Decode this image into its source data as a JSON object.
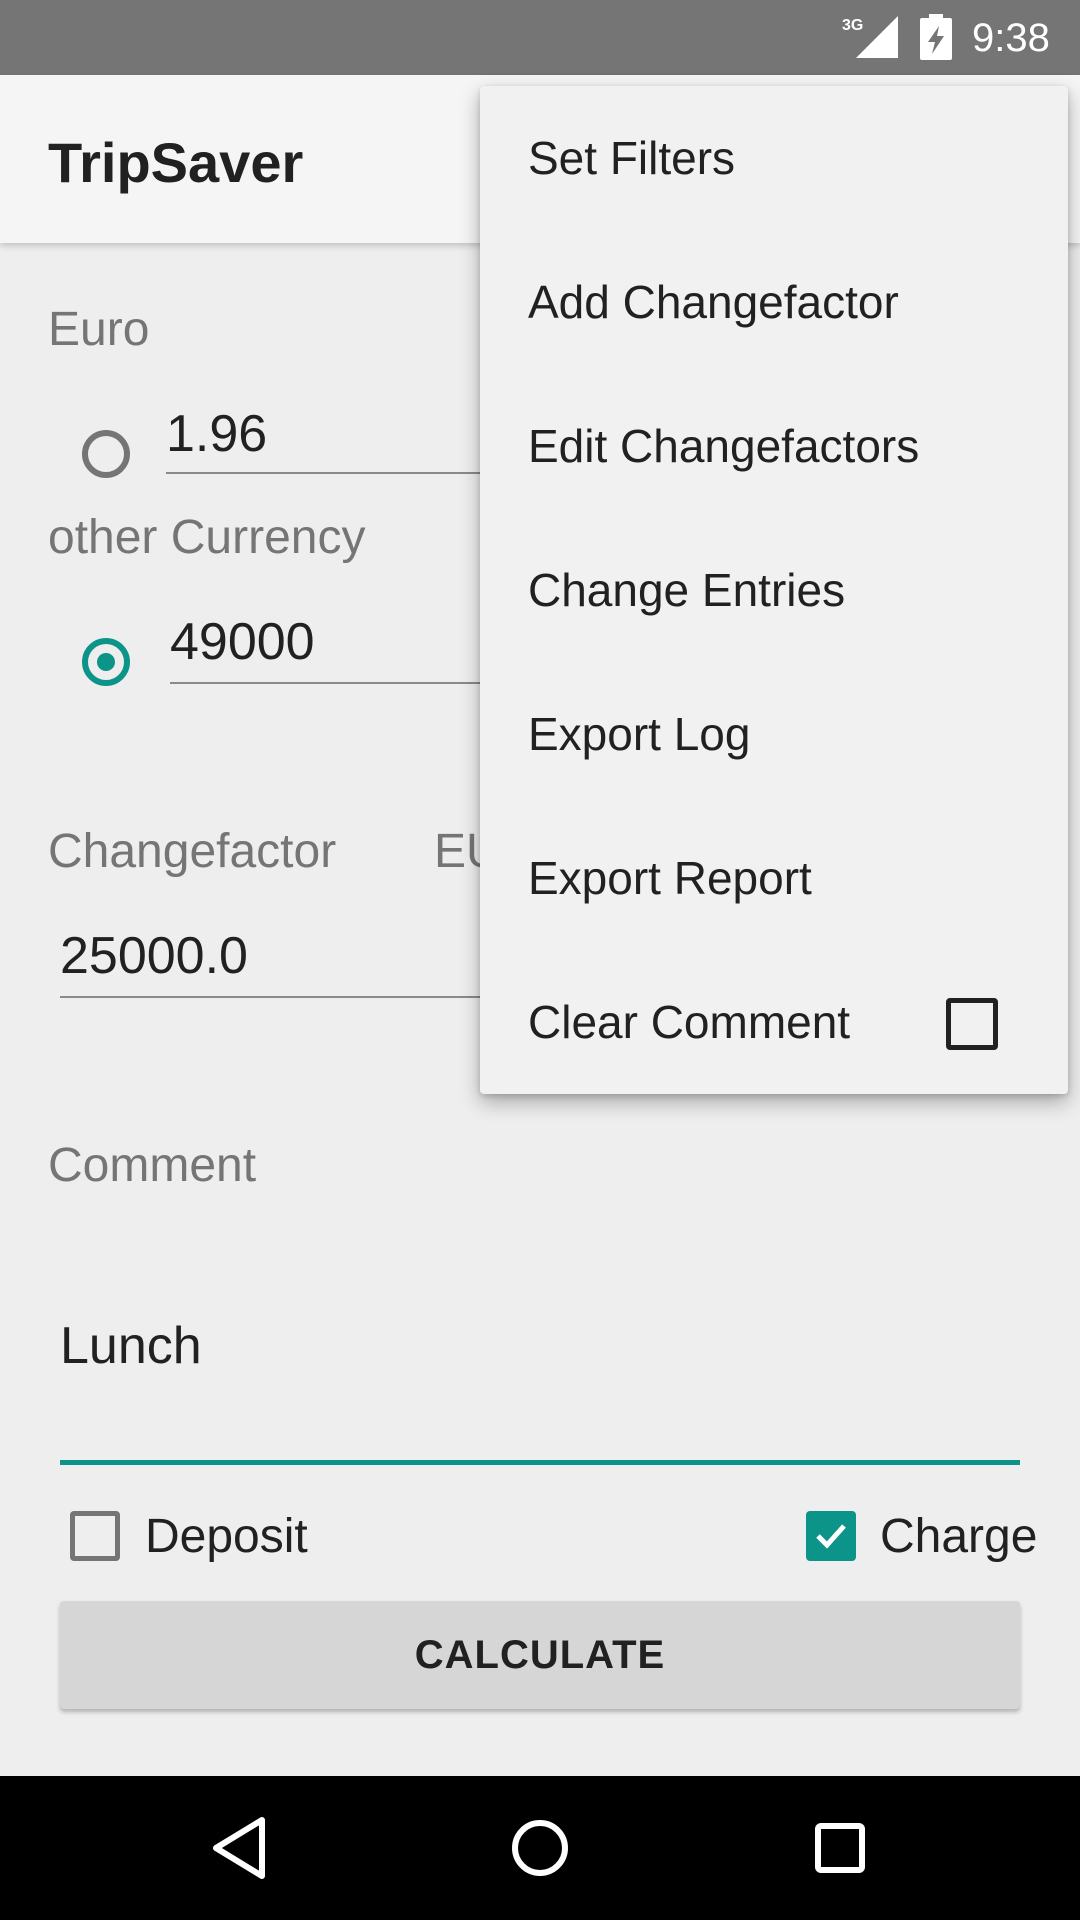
{
  "status_bar": {
    "network": "3G",
    "time": "9:38",
    "signal_icon": "cell-signal-icon",
    "battery_icon": "battery-charging-icon"
  },
  "app_bar": {
    "title": "TripSaver"
  },
  "form": {
    "euro_label": "Euro",
    "euro_value": "1.96",
    "euro_selected": false,
    "other_currency_label": "other Currency",
    "other_currency_value": "49000",
    "other_currency_selected": true,
    "changefactor_label": "Changefactor",
    "changefactor_currency_partial": "EU",
    "changefactor_value": "25000.0",
    "comment_label": "Comment",
    "comment_value": "Lunch",
    "deposit_label": "Deposit",
    "deposit_checked": false,
    "charge_label": "Charge",
    "charge_checked": true,
    "calculate_label": "CALCULATE"
  },
  "overflow_menu": {
    "items": [
      {
        "label": "Set Filters"
      },
      {
        "label": "Add Changefactor"
      },
      {
        "label": "Edit Changefactors"
      },
      {
        "label": "Change Entries"
      },
      {
        "label": "Export Log"
      },
      {
        "label": "Export Report"
      },
      {
        "label": "Clear Comment",
        "checkbox": true,
        "checked": false
      }
    ]
  },
  "nav_bar": {
    "back_icon": "back-triangle-icon",
    "home_icon": "home-circle-icon",
    "recents_icon": "recents-square-icon"
  },
  "colors": {
    "accent": "#0d9488",
    "status_bar": "#757575",
    "background": "#eeeeee",
    "menu_background": "#f1f1f1"
  }
}
